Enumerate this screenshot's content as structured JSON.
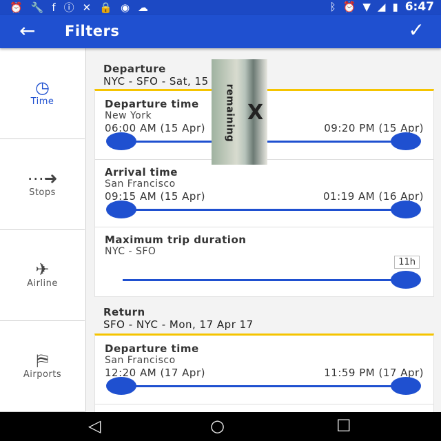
{
  "status_bar": {
    "time": "6:47",
    "left_icons": [
      "alarm-icon",
      "wrench-icon",
      "facebook-icon",
      "info-icon",
      "satellite-icon",
      "lock-icon",
      "robot-icon",
      "cloud-icon"
    ],
    "right_icons": [
      "bluetooth-icon",
      "alarm-icon",
      "wifi-icon",
      "signal-icon",
      "battery-icon"
    ]
  },
  "app_bar": {
    "title": "Filters",
    "back_glyph": "←",
    "done_glyph": "✓"
  },
  "sidebar": {
    "items": [
      {
        "label": "Time",
        "icon": "clock-icon",
        "glyph": "◷"
      },
      {
        "label": "Stops",
        "icon": "stops-arrow-icon",
        "glyph": "⋯➜"
      },
      {
        "label": "Airline",
        "icon": "airplane-icon",
        "glyph": "✈"
      },
      {
        "label": "Airports",
        "icon": "airports-icon",
        "glyph": "⛿"
      }
    ]
  },
  "departure": {
    "heading": "Departure",
    "route_date": "NYC - SFO - Sat, 15 Apr 17",
    "rows": [
      {
        "title": "Departure time",
        "subtitle": "New York",
        "min": "06:00 AM (15 Apr)",
        "max": "09:20 PM (15 Apr)"
      },
      {
        "title": "Arrival time",
        "subtitle": "San Francisco",
        "min": "09:15 AM (15 Apr)",
        "max": "01:19 AM (16 Apr)"
      },
      {
        "title": "Maximum trip duration",
        "subtitle": "NYC - SFO",
        "badge": "11h"
      }
    ]
  },
  "return": {
    "heading": "Return",
    "route_date": "SFO - NYC - Mon, 17 Apr 17",
    "rows": [
      {
        "title": "Departure time",
        "subtitle": "San Francisco",
        "min": "12:20 AM (17 Apr)",
        "max": "11:59 PM (17 Apr)"
      }
    ]
  },
  "overlay_ad": {
    "text": "remaining",
    "close": "X"
  },
  "nav_bar": {
    "back": "◁",
    "home": "○",
    "recents": "☐"
  }
}
